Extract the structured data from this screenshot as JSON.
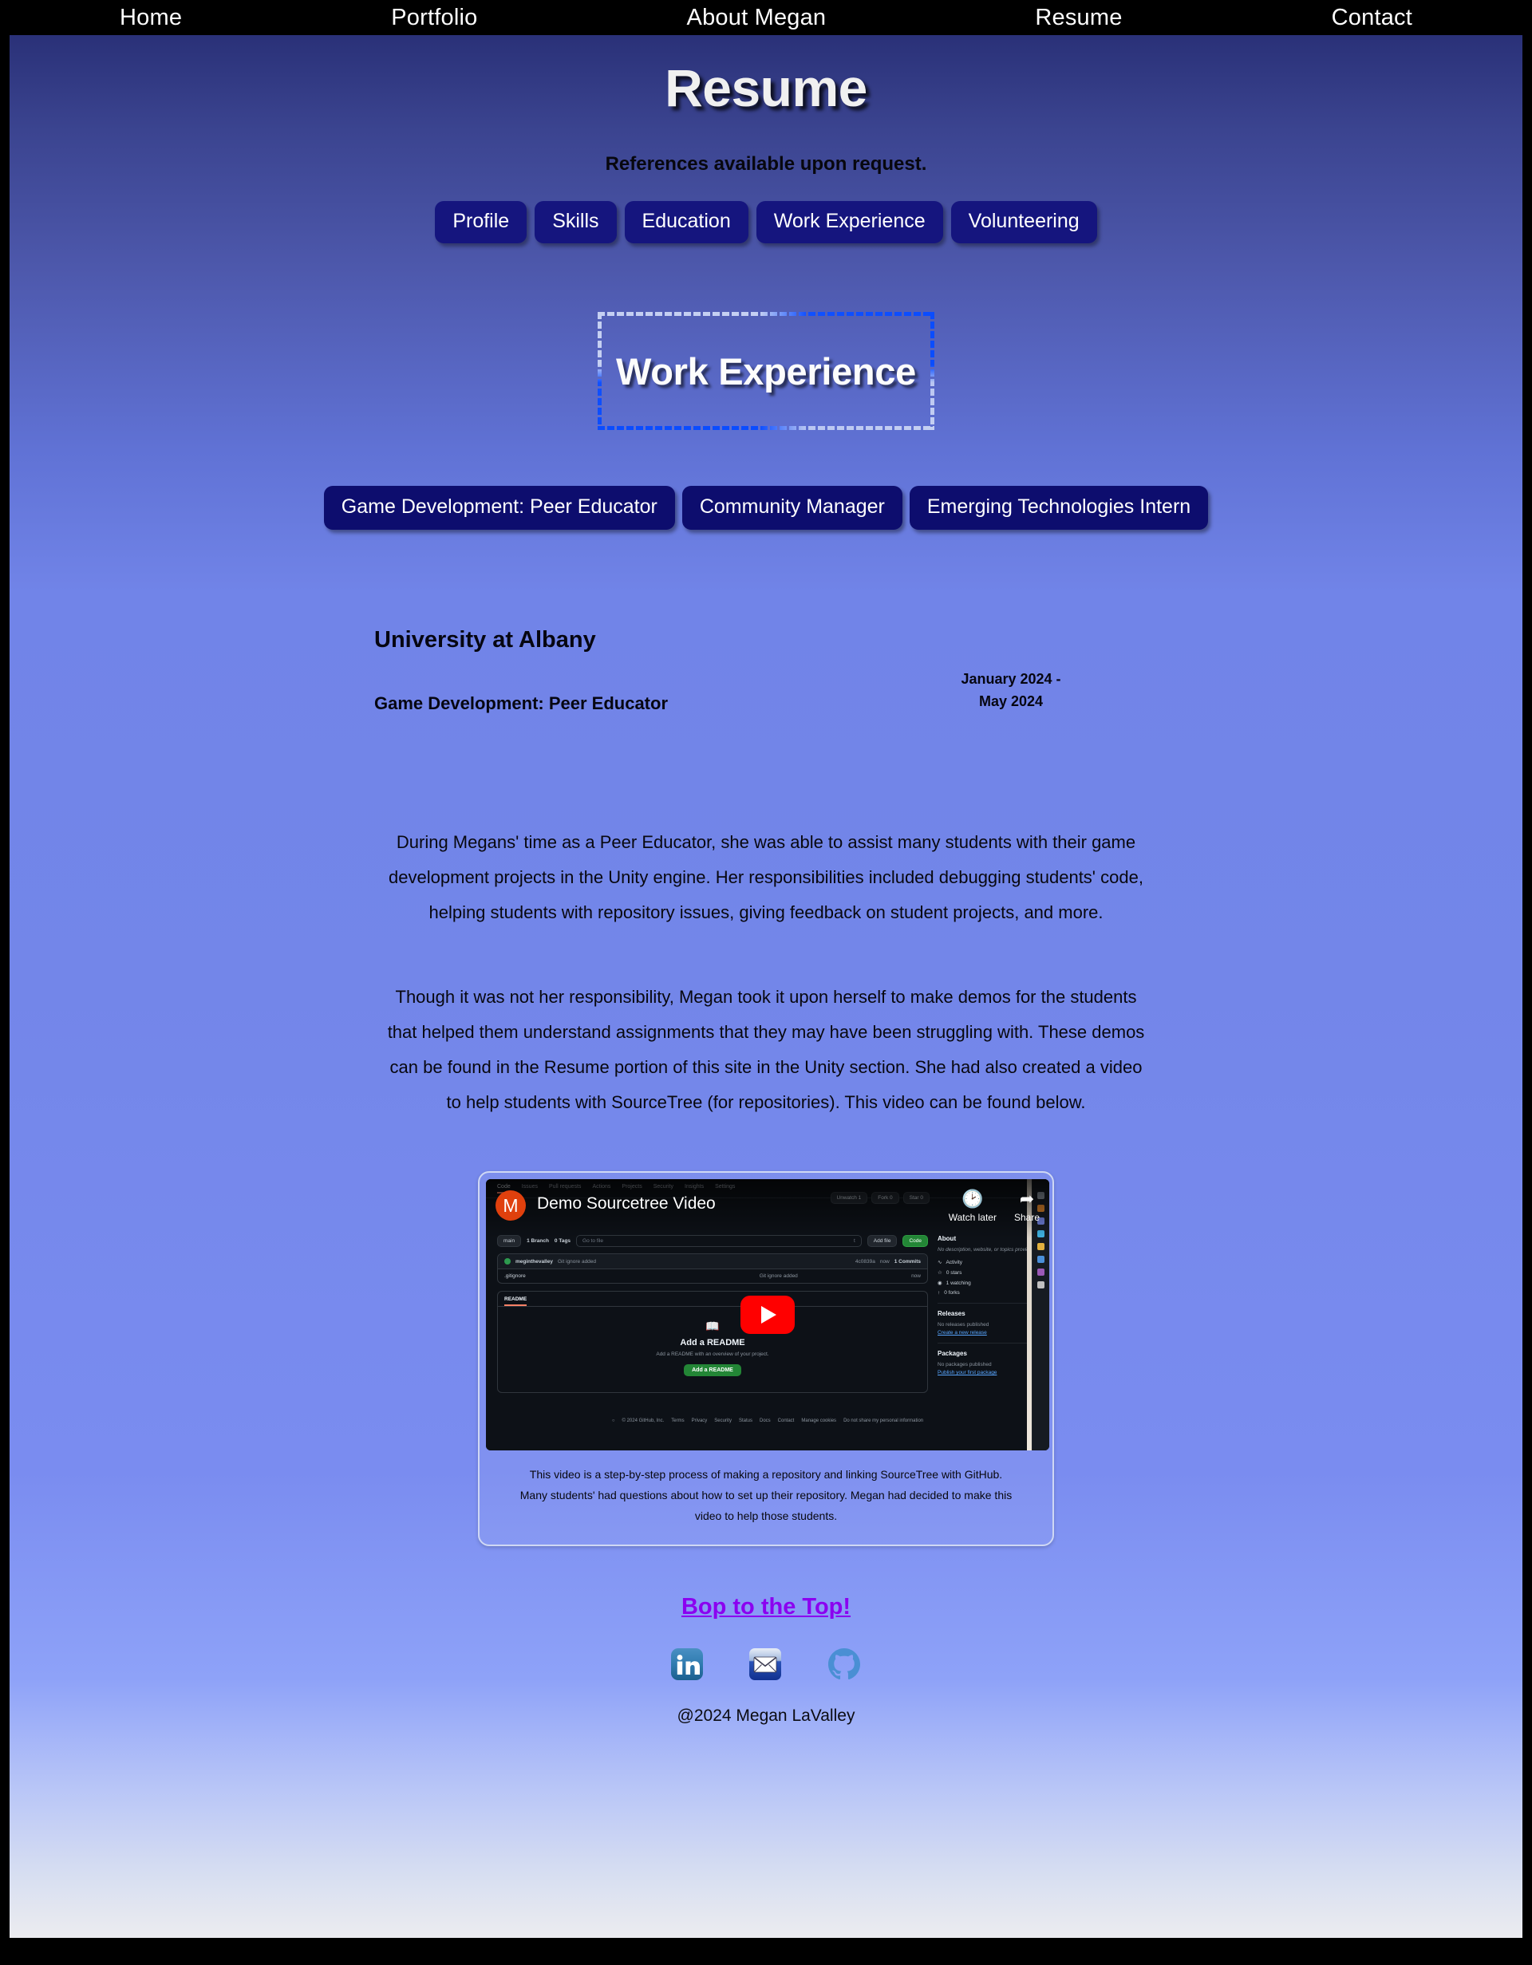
{
  "nav": {
    "items": [
      {
        "label": "Home",
        "name": "nav-home"
      },
      {
        "label": "Portfolio",
        "name": "nav-portfolio"
      },
      {
        "label": "About Megan",
        "name": "nav-about-megan"
      },
      {
        "label": "Resume",
        "name": "nav-resume"
      },
      {
        "label": "Contact",
        "name": "nav-contact"
      }
    ]
  },
  "header": {
    "title": "Resume",
    "subtitle": "References available upon request."
  },
  "section_nav": {
    "buttons": [
      "Profile",
      "Skills",
      "Education",
      "Work Experience",
      "Volunteering"
    ]
  },
  "section": {
    "heading": "Work Experience"
  },
  "job_tabs": [
    "Game Development: Peer Educator",
    "Community Manager",
    "Emerging Technologies Intern"
  ],
  "job_card": {
    "organization": "University at Albany",
    "role": "Game Development: Peer Educator",
    "dates_line1": "January 2024 -",
    "dates_line2": "May 2024"
  },
  "paragraphs": {
    "p1": "During Megans' time as a Peer Educator, she was able to assist many students with their game development projects in the Unity engine. Her responsibilities included debugging students' code, helping students with repository issues, giving feedback on student projects, and more.",
    "p2": "Though it was not her responsibility, Megan took it upon herself to make demos for the students that helped them understand assignments that they may have been struggling with. These demos can be found in the Resume portion of this site in the Unity section. She had also created a video to help students with SourceTree (for repositories). This video can be found below."
  },
  "video": {
    "title": "Demo Sourcetree Video",
    "avatar_initial": "M",
    "watch_later_label": "Watch later",
    "share_label": "Share",
    "caption": "This video is a step-by-step process of making a repository and linking SourceTree with GitHub. Many students' had questions about how to set up their repository. Megan had decided to make this video to help those students.",
    "thumbnail": {
      "nav_tabs": [
        "Code",
        "Issues",
        "Pull requests",
        "Actions",
        "Projects",
        "Security",
        "Insights",
        "Settings"
      ],
      "repo_actions": [
        "Unwatch  1",
        "Fork  0",
        "Star  0"
      ],
      "branch_button": "main",
      "branch_count": "1 Branch",
      "tag_count": "0 Tags",
      "search_placeholder": "Go to file",
      "search_key": "t",
      "add_file_button": "Add file",
      "code_button": "Code",
      "commit_author": "meginthevalley",
      "commit_message": "Git ignore added",
      "commit_hash": "4c0839a",
      "commit_time": "now",
      "commit_count": "1 Commits",
      "file_name": ".gitignore",
      "file_message": "Git ignore added",
      "file_time": "now",
      "readme_tab": "README",
      "readme_heading": "Add a README",
      "readme_sub": "Add a README with an overview of your project.",
      "readme_button": "Add a README",
      "about_heading": "About",
      "about_text": "No description, website, or topics provided.",
      "stats": [
        "Activity",
        "0 stars",
        "1 watching",
        "0 forks"
      ],
      "releases_heading": "Releases",
      "releases_text": "No releases published",
      "releases_link": "Create a new release",
      "packages_heading": "Packages",
      "packages_text": "No packages published",
      "packages_link": "Publish your first package",
      "footer_copyright": "© 2024 GitHub, Inc.",
      "footer_links": [
        "Terms",
        "Privacy",
        "Security",
        "Status",
        "Docs",
        "Contact",
        "Manage cookies",
        "Do not share my personal information"
      ]
    }
  },
  "footer": {
    "top_link": "Bop to the Top!",
    "socials": [
      {
        "name": "linkedin-icon",
        "label": "LinkedIn"
      },
      {
        "name": "email-icon",
        "label": "Email"
      },
      {
        "name": "github-icon",
        "label": "GitHub"
      }
    ],
    "copyright": "@2024 Megan LaValley"
  },
  "colors": {
    "nav_bg": "#000000",
    "button_navy": "#15157e",
    "tab_navy": "#0d0d6e",
    "gradient_top": "#2a3178",
    "gradient_mid": "#7184e8",
    "gradient_bottom": "#ececf0",
    "link_purple": "#8b00f0",
    "border_blue": "#0a4cff",
    "border_light": "#c5d0f2",
    "youtube_red": "#ff0000",
    "avatar_orange": "#e0400d"
  }
}
